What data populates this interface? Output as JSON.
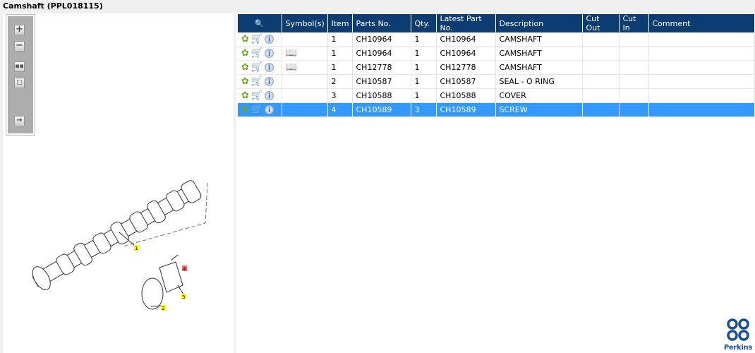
{
  "title": "Camshaft (PPL018115)",
  "toolbar": {
    "icons": [
      "zoom-in-icon",
      "zoom-out-icon",
      "fit-all-icon",
      "fit-window-icon",
      "show-parts-list-icon"
    ]
  },
  "diagram": {
    "callouts": [
      "1",
      "2",
      "3",
      "4"
    ]
  },
  "table": {
    "headers": [
      "",
      "Symbol(s)",
      "Item",
      "Parts No.",
      "Qty.",
      "Latest Part No.",
      "Description",
      "Cut Out",
      "Cut In",
      "Comment"
    ],
    "rows": [
      {
        "symbol": "",
        "item": "1",
        "part": "CH10964",
        "qty": "1",
        "latest": "CH10964",
        "desc": "CAMSHAFT",
        "cutout": "",
        "cutin": "",
        "comment": ""
      },
      {
        "symbol": "book",
        "item": "1",
        "part": "CH10964",
        "qty": "1",
        "latest": "CH10964",
        "desc": "CAMSHAFT",
        "cutout": "",
        "cutin": "",
        "comment": ""
      },
      {
        "symbol": "book",
        "item": "1",
        "part": "CH12778",
        "qty": "1",
        "latest": "CH12778",
        "desc": "CAMSHAFT",
        "cutout": "",
        "cutin": "",
        "comment": ""
      },
      {
        "symbol": "",
        "item": "2",
        "part": "CH10587",
        "qty": "1",
        "latest": "CH10587",
        "desc": "SEAL - O RING",
        "cutout": "",
        "cutin": "",
        "comment": ""
      },
      {
        "symbol": "",
        "item": "3",
        "part": "CH10588",
        "qty": "1",
        "latest": "CH10588",
        "desc": "COVER",
        "cutout": "",
        "cutin": "",
        "comment": ""
      },
      {
        "symbol": "",
        "item": "4",
        "part": "CH10589",
        "qty": "3",
        "latest": "CH10589",
        "desc": "SCREW",
        "cutout": "",
        "cutin": "",
        "comment": "",
        "selected": true
      }
    ]
  },
  "brand": {
    "name": "Perkins",
    "color": "#1b4f93"
  },
  "colors": {
    "header": "#0b3c72",
    "selected": "#3399ff"
  }
}
